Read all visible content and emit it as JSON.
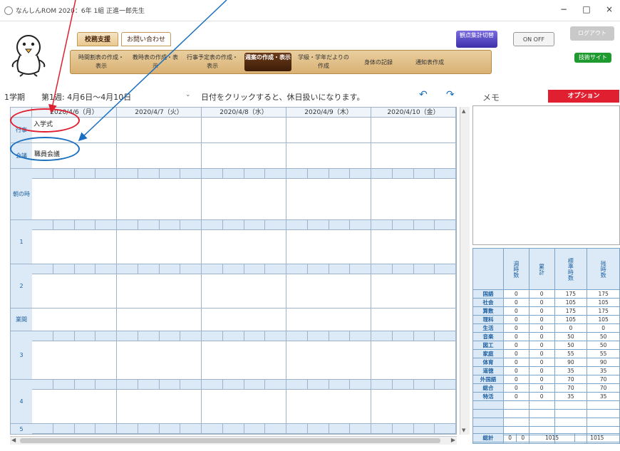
{
  "window": {
    "title": "なんしんROM 2020：6年 1組 正進一郎先生",
    "minimize": "−",
    "maximize": "□",
    "close": "×"
  },
  "top_tabs": {
    "support": "校務支援",
    "inquiry": "お問い合わせ"
  },
  "nav": [
    {
      "label": "時間割表の作成・表示"
    },
    {
      "label": "教時表の作成・表示"
    },
    {
      "label": "行事予定表の作成・表示"
    },
    {
      "label": "週案の作成・表示",
      "active": true
    },
    {
      "label": "学級・学年だよりの作成"
    },
    {
      "label": "身体の記録"
    },
    {
      "label": "通知表作成"
    }
  ],
  "right_buttons": {
    "kanten": "観点集計切替",
    "onoff": "ON OFF",
    "logout": "ログアウト",
    "status": "技術サイト"
  },
  "week": {
    "term": "1学期",
    "range": "第1週: 4月6日〜4月10日",
    "hint": "日付をクリックすると、休日扱いになります。",
    "memo_label": "メモ",
    "option": "オプション"
  },
  "days": [
    {
      "date": "2020/4/6（月）"
    },
    {
      "date": "2020/4/7（火）"
    },
    {
      "date": "2020/4/8（水）"
    },
    {
      "date": "2020/4/9（木）"
    },
    {
      "date": "2020/4/10（金）"
    }
  ],
  "rows": {
    "event": "行事",
    "meeting": "会議",
    "morning": "朝の時間",
    "p1": "1",
    "p2": "2",
    "recess": "業間",
    "p3": "3",
    "p4": "4",
    "p5": "5"
  },
  "cells": {
    "event_mon": "入学式",
    "meeting_mon": "職員会議"
  },
  "summary": {
    "headers": [
      "週時数",
      "累計",
      "標準時数",
      "残時数"
    ],
    "subjects": [
      {
        "name": "国語",
        "v": [
          "0",
          "0",
          "175",
          "175"
        ]
      },
      {
        "name": "社会",
        "v": [
          "0",
          "0",
          "105",
          "105"
        ]
      },
      {
        "name": "算数",
        "v": [
          "0",
          "0",
          "175",
          "175"
        ]
      },
      {
        "name": "理科",
        "v": [
          "0",
          "0",
          "105",
          "105"
        ]
      },
      {
        "name": "生活",
        "v": [
          "0",
          "0",
          "0",
          "0"
        ]
      },
      {
        "name": "音楽",
        "v": [
          "0",
          "0",
          "50",
          "50"
        ]
      },
      {
        "name": "図工",
        "v": [
          "0",
          "0",
          "50",
          "50"
        ]
      },
      {
        "name": "家庭",
        "v": [
          "0",
          "0",
          "55",
          "55"
        ]
      },
      {
        "name": "体育",
        "v": [
          "0",
          "0",
          "90",
          "90"
        ]
      },
      {
        "name": "道徳",
        "v": [
          "0",
          "0",
          "35",
          "35"
        ]
      },
      {
        "name": "外国語",
        "v": [
          "0",
          "0",
          "70",
          "70"
        ]
      },
      {
        "name": "総合",
        "v": [
          "0",
          "0",
          "70",
          "70"
        ]
      },
      {
        "name": "特活",
        "v": [
          "0",
          "0",
          "35",
          "35"
        ]
      }
    ],
    "total_label": "総計",
    "total": [
      "0",
      "0",
      "1015",
      "1015"
    ]
  },
  "colors": {
    "accent_red": "#e02030",
    "accent_blue": "#1a6fc0",
    "grid_blue": "#dbeaf6",
    "nav_active": "#4a2510"
  }
}
